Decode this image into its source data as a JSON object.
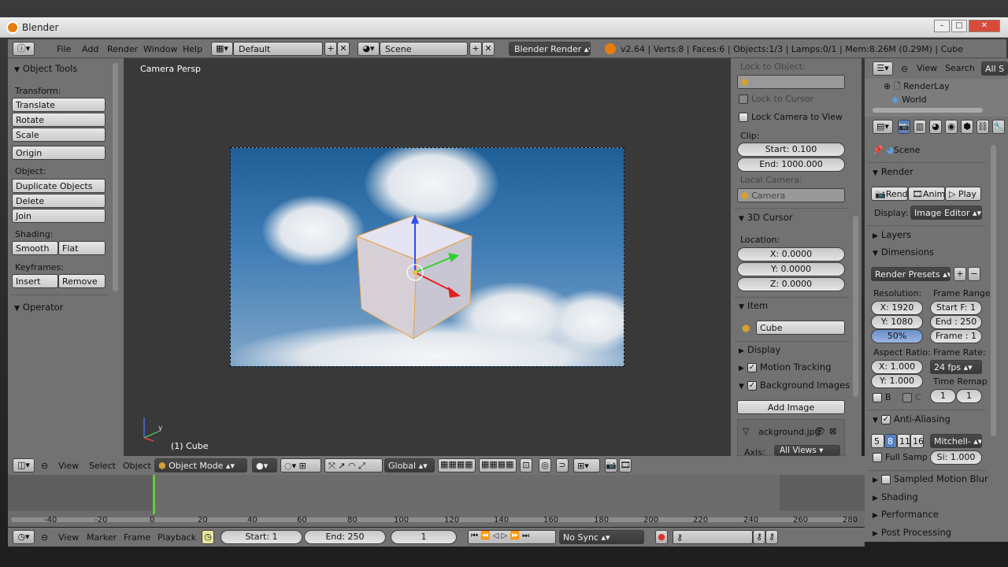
{
  "window": {
    "title": "Blender",
    "controls": [
      "–",
      "□",
      "✕"
    ]
  },
  "info_header": {
    "menus": [
      "File",
      "Add",
      "Render",
      "Window",
      "Help"
    ],
    "layout": "Default",
    "scene": "Scene",
    "engine": "Blender Render",
    "stats": "v2.64 | Verts:8 | Faces:6 | Objects:1/3 | Lamps:0/1 | Mem:8.26M (0.29M) | Cube"
  },
  "tools": {
    "title": "Object Tools",
    "transform_label": "Transform:",
    "translate": "Translate",
    "rotate": "Rotate",
    "scale": "Scale",
    "origin": "Origin",
    "object_label": "Object:",
    "duplicate": "Duplicate Objects",
    "delete": "Delete",
    "join": "Join",
    "shading_label": "Shading:",
    "smooth": "Smooth",
    "flat": "Flat",
    "keyframes_label": "Keyframes:",
    "insert": "Insert",
    "remove": "Remove",
    "operator": "Operator"
  },
  "viewport": {
    "view_name": "Camera Persp",
    "object_label": "(1) Cube",
    "axes": [
      "z",
      "y",
      "x"
    ]
  },
  "view_properties": {
    "lock_to_object": "Lock to Object:",
    "lock_to_cursor": "Lock to Cursor",
    "lock_camera": "Lock Camera to View",
    "clip_label": "Clip:",
    "clip_start": "Start: 0.100",
    "clip_end": "End: 1000.000",
    "local_camera_label": "Local Camera:",
    "camera": "Camera",
    "cursor_header": "3D Cursor",
    "location_label": "Location:",
    "cursor_x": "X: 0.0000",
    "cursor_y": "Y: 0.0000",
    "cursor_z": "Z: 0.0000",
    "item_header": "Item",
    "item_name": "Cube",
    "display_header": "Display",
    "motion_tracking": "Motion Tracking",
    "background_images": "Background Images",
    "add_image": "Add Image",
    "bg_file": "ackground.jpg",
    "axis_label": "Axis:",
    "axis_value": "All Views"
  },
  "outliner": {
    "view": "View",
    "search": "Search",
    "all": "All S",
    "items": [
      "RenderLay",
      "World"
    ]
  },
  "properties": {
    "context": "Scene",
    "render_header": "Render",
    "render_btn": "Rende",
    "anim_btn": "Anima",
    "play_btn": "Play",
    "display_label": "Display:",
    "display_value": "Image Editor",
    "layers": "Layers",
    "dimensions": "Dimensions",
    "presets": "Render Presets",
    "resolution_label": "Resolution:",
    "res_x": "X: 1920",
    "res_y": "Y: 1080",
    "res_pct": "50%",
    "frame_range_label": "Frame Range:",
    "start_f": "Start F: 1",
    "end_f": "End : 250",
    "frame": "Frame : 1",
    "aspect_label": "Aspect Ratio:",
    "aspect_x": "X: 1.000",
    "aspect_y": "Y: 1.000",
    "frame_rate_label": "Frame Rate:",
    "fps": "24 fps",
    "time_remap": "Time Remap",
    "remap_old": "1",
    "remap_new": "1",
    "b": "B",
    "c": "C",
    "anti_aliasing": "Anti-Aliasing",
    "aa_samples": [
      "5",
      "8",
      "11",
      "16"
    ],
    "aa_filter": "Mitchell-",
    "full_sample": "Full Samp",
    "filter_size": "Si: 1.000",
    "sampled_motion_blur": "Sampled Motion Blur",
    "shading": "Shading",
    "performance": "Performance",
    "post_processing": "Post Processing"
  },
  "viewport_header": {
    "menus": [
      "View",
      "Select",
      "Object"
    ],
    "mode": "Object Mode",
    "orientation": "Global"
  },
  "timeline": {
    "ticks": [
      "-40",
      "-20",
      "0",
      "20",
      "40",
      "60",
      "80",
      "100",
      "120",
      "140",
      "160",
      "180",
      "200",
      "220",
      "240",
      "260",
      "280"
    ],
    "menus": [
      "View",
      "Marker",
      "Frame",
      "Playback"
    ],
    "start": "Start: 1",
    "end": "End: 250",
    "current": "1",
    "sync": "No Sync"
  },
  "colors": {
    "accent": "#e87d0d",
    "panel": "#727272",
    "viewport": "#393939",
    "selected": "#5680c2"
  }
}
